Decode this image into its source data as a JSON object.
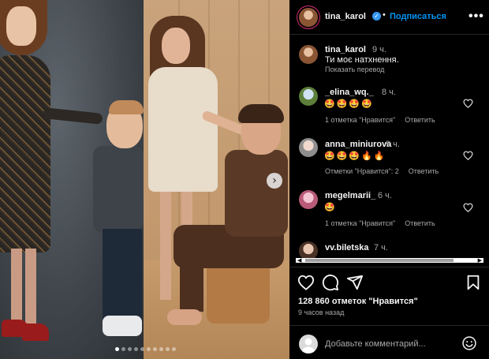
{
  "post": {
    "author": "tina_karol",
    "follow_label": "Подписаться",
    "dot": "•",
    "more_label": "•••",
    "caption": {
      "user": "tina_karol",
      "time": "9 ч.",
      "text": "Ти моє натхнення.",
      "translate": "Показать перевод"
    },
    "comments": [
      {
        "user": "_elina_wq._",
        "time": "8 ч.",
        "emojis": "🤩🤩🤩🤩",
        "likes": "1 отметка \"Нравится\"",
        "reply": "Ответить"
      },
      {
        "user": "anna_miniurova",
        "time": "9 ч.",
        "emojis": "🤩🤩🤩🔥🔥",
        "likes": "Отметки \"Нравится\": 2",
        "reply": "Ответить"
      },
      {
        "user": "megelmarii_",
        "time": "6 ч.",
        "emojis": "🤩",
        "likes": "1 отметка \"Нравится\"",
        "reply": "Ответить"
      },
      {
        "user": "vv.biletska",
        "time": "7 ч.",
        "emojis": "",
        "likes": "",
        "reply": ""
      }
    ],
    "likes_count": "128 860 отметок \"Нравится\"",
    "time_ago": "9 часов назад",
    "add_comment_placeholder": "Добавьте комментарий..."
  },
  "carousel": {
    "next_label": "›",
    "slides_total": 10,
    "active_index": 0
  },
  "colors": {
    "accent": "#0095f6",
    "verified": "#3897f0",
    "background": "#000000",
    "secondary_text": "#a8a8a8"
  },
  "icons": [
    "heart-icon",
    "comment-icon",
    "share-icon",
    "bookmark-icon",
    "emoji-icon",
    "verified-badge-icon",
    "more-options-icon"
  ]
}
